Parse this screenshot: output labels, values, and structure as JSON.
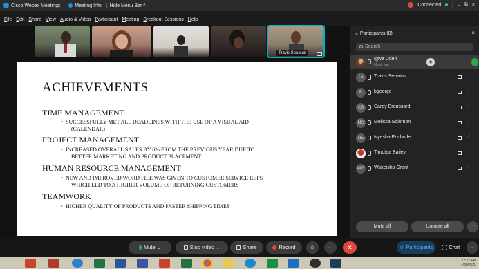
{
  "titlebar": {
    "app": "Cisco Webex Meetings",
    "meeting_info": "Meeting Info",
    "hide_menu": "Hide Menu Bar ^",
    "status": "Connected",
    "minimize": "–",
    "restore": "⧉",
    "close": "×"
  },
  "menu": [
    "File",
    "Edit",
    "Share",
    "View",
    "Audio & Video",
    "Participant",
    "Meeting",
    "Breakout Sessions",
    "Help"
  ],
  "thumbnails": [
    {
      "name": "",
      "colors": [
        "#7d8a6f",
        "#2d2a2a"
      ]
    },
    {
      "name": "",
      "colors": [
        "#c99f8c",
        "#4b2b2a"
      ]
    },
    {
      "name": "",
      "colors": [
        "#e2e0dc",
        "#3a2f2e"
      ]
    },
    {
      "name": "",
      "colors": [
        "#4a403b",
        "#1e1a19"
      ]
    },
    {
      "name": "Travis Senatus",
      "colors": [
        "#a89b86",
        "#3e3330"
      ]
    }
  ],
  "slide": {
    "title": "ACHIEVEMENTS",
    "sections": [
      {
        "heading": "TIME MANAGEMENT",
        "bullets": [
          [
            "SUCCESSFULLY MET ALL DEADLINES WITH THE USE OF A VISUAL AID",
            "(CALENDAR)"
          ]
        ]
      },
      {
        "heading": "PROJECT MANAGEMENT",
        "bullets": [
          [
            "INCREASED OVERALL SALES BY 6% FROM THE PREVIOUS YEAR DUE TO",
            "BETTER MARKETING AND PRODUCT PLACEMENT"
          ]
        ]
      },
      {
        "heading": "HUMAN RESOURCE MANAGEMENT",
        "bullets": [
          [
            "NEW AND IMPROVED WORD FILE WAS GIVEN TO CUSTOMER SERVICE REPS",
            "WHICH LED TO A HIGHER VOLUME OF RETURNING CUSTOMERS"
          ]
        ]
      },
      {
        "heading": "TEAMWORK",
        "bullets": [
          [
            "HIGHER QUALITY OF PRODUCTS AND FASTER SHIPPING TIMES",
            ""
          ]
        ]
      }
    ]
  },
  "participants": {
    "header": "Participants (8)",
    "search_placeholder": "Search",
    "list": [
      {
        "name": "Igwe Udeh",
        "sub": "Host, me",
        "initials": "",
        "avatar": "photo"
      },
      {
        "name": "Travis Senatus",
        "sub": "",
        "initials": "TS",
        "avatar": "initials"
      },
      {
        "name": "bgeorge",
        "sub": "",
        "initials": "B",
        "avatar": "initials"
      },
      {
        "name": "Carey Broussard",
        "sub": "",
        "initials": "CB",
        "avatar": "initials"
      },
      {
        "name": "Melissa Solomon",
        "sub": "",
        "initials": "MS",
        "avatar": "initials"
      },
      {
        "name": "Nyesha Enclarde",
        "sub": "",
        "initials": "NE",
        "avatar": "initials"
      },
      {
        "name": "Timotea Bailey",
        "sub": "",
        "initials": "",
        "avatar": "red"
      },
      {
        "name": "Wakeisha Grant",
        "sub": "",
        "initials": "WG",
        "avatar": "initials"
      }
    ],
    "mute_all": "Mute all",
    "unmute_all": "Unmute all",
    "more": "···"
  },
  "controls": {
    "mute": "Mute",
    "stop_video": "Stop video",
    "share": "Share",
    "record": "Record",
    "more": "···",
    "end": "✕",
    "participants_tab": "Participants",
    "chat_tab": "Chat",
    "more_right": "···"
  },
  "taskbar": {
    "time": "12:22 PM",
    "date": "7/30/2020"
  },
  "colors": {
    "accent": "#00b3c7",
    "record_red": "#e0463c",
    "mic_green": "#2ea84f",
    "active_tab": "#5fb2ff"
  }
}
